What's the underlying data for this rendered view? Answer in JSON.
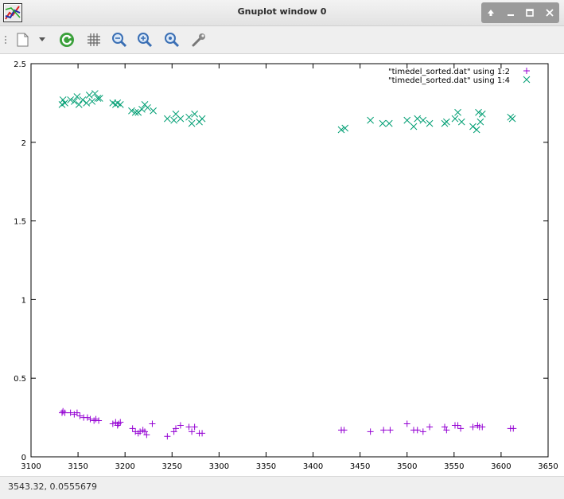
{
  "window": {
    "title": "Gnuplot window 0",
    "controls": [
      "up-icon",
      "minimize-icon",
      "maximize-icon",
      "close-icon"
    ]
  },
  "toolbar": {
    "items": [
      "grip-icon",
      "copy-icon",
      "dropdown-arrow-icon",
      "replot-icon",
      "grid-icon",
      "zoom-previous-icon",
      "zoom-next-icon",
      "unzoom-icon",
      "settings-icon"
    ]
  },
  "status": {
    "coordinates": "3543.32,  0.0555679"
  },
  "colors": {
    "series1": "#9400d3",
    "series2": "#009e73"
  },
  "chart_data": {
    "type": "scatter",
    "xlim": [
      3100,
      3650
    ],
    "ylim": [
      0,
      2.5
    ],
    "xticks": [
      "3100",
      "3150",
      "3200",
      "3250",
      "3300",
      "3350",
      "3400",
      "3450",
      "3500",
      "3550",
      "3600",
      "3650"
    ],
    "yticks": [
      "0",
      "0.5",
      "1",
      "1.5",
      "2",
      "2.5"
    ],
    "legend_position": "top-right",
    "grid": false,
    "series": [
      {
        "name": "\"timedel_sorted.dat\" using 1:2",
        "marker": "plus",
        "points": [
          [
            3133,
            0.28
          ],
          [
            3134,
            0.29
          ],
          [
            3136,
            0.28
          ],
          [
            3142,
            0.28
          ],
          [
            3146,
            0.27
          ],
          [
            3149,
            0.28
          ],
          [
            3152,
            0.26
          ],
          [
            3156,
            0.25
          ],
          [
            3160,
            0.25
          ],
          [
            3163,
            0.24
          ],
          [
            3167,
            0.23
          ],
          [
            3169,
            0.24
          ],
          [
            3172,
            0.23
          ],
          [
            3187,
            0.21
          ],
          [
            3190,
            0.22
          ],
          [
            3192,
            0.2
          ],
          [
            3193,
            0.21
          ],
          [
            3195,
            0.22
          ],
          [
            3208,
            0.18
          ],
          [
            3211,
            0.16
          ],
          [
            3214,
            0.15
          ],
          [
            3216,
            0.16
          ],
          [
            3219,
            0.17
          ],
          [
            3221,
            0.16
          ],
          [
            3223,
            0.14
          ],
          [
            3229,
            0.21
          ],
          [
            3245,
            0.13
          ],
          [
            3252,
            0.16
          ],
          [
            3254,
            0.18
          ],
          [
            3259,
            0.2
          ],
          [
            3268,
            0.19
          ],
          [
            3271,
            0.16
          ],
          [
            3274,
            0.19
          ],
          [
            3279,
            0.15
          ],
          [
            3282,
            0.15
          ],
          [
            3430,
            0.17
          ],
          [
            3433,
            0.17
          ],
          [
            3461,
            0.16
          ],
          [
            3475,
            0.17
          ],
          [
            3482,
            0.17
          ],
          [
            3500,
            0.21
          ],
          [
            3507,
            0.17
          ],
          [
            3511,
            0.17
          ],
          [
            3517,
            0.16
          ],
          [
            3524,
            0.19
          ],
          [
            3540,
            0.19
          ],
          [
            3542,
            0.17
          ],
          [
            3551,
            0.2
          ],
          [
            3554,
            0.2
          ],
          [
            3557,
            0.18
          ],
          [
            3570,
            0.19
          ],
          [
            3575,
            0.2
          ],
          [
            3577,
            0.19
          ],
          [
            3580,
            0.19
          ],
          [
            3610,
            0.18
          ],
          [
            3613,
            0.18
          ]
        ]
      },
      {
        "name": "\"timedel_sorted.dat\" using 1:4",
        "marker": "cross",
        "points": [
          [
            3133,
            2.24
          ],
          [
            3134,
            2.27
          ],
          [
            3136,
            2.25
          ],
          [
            3142,
            2.27
          ],
          [
            3146,
            2.26
          ],
          [
            3149,
            2.29
          ],
          [
            3151,
            2.24
          ],
          [
            3155,
            2.27
          ],
          [
            3159,
            2.25
          ],
          [
            3162,
            2.3
          ],
          [
            3165,
            2.26
          ],
          [
            3168,
            2.31
          ],
          [
            3171,
            2.28
          ],
          [
            3173,
            2.28
          ],
          [
            3187,
            2.25
          ],
          [
            3190,
            2.24
          ],
          [
            3192,
            2.25
          ],
          [
            3195,
            2.24
          ],
          [
            3207,
            2.2
          ],
          [
            3211,
            2.19
          ],
          [
            3214,
            2.19
          ],
          [
            3218,
            2.21
          ],
          [
            3221,
            2.24
          ],
          [
            3224,
            2.22
          ],
          [
            3230,
            2.2
          ],
          [
            3245,
            2.15
          ],
          [
            3252,
            2.14
          ],
          [
            3254,
            2.18
          ],
          [
            3259,
            2.15
          ],
          [
            3268,
            2.16
          ],
          [
            3271,
            2.12
          ],
          [
            3274,
            2.18
          ],
          [
            3279,
            2.13
          ],
          [
            3282,
            2.15
          ],
          [
            3430,
            2.08
          ],
          [
            3434,
            2.09
          ],
          [
            3461,
            2.14
          ],
          [
            3474,
            2.12
          ],
          [
            3481,
            2.12
          ],
          [
            3500,
            2.14
          ],
          [
            3507,
            2.1
          ],
          [
            3511,
            2.15
          ],
          [
            3517,
            2.14
          ],
          [
            3524,
            2.12
          ],
          [
            3540,
            2.12
          ],
          [
            3542,
            2.13
          ],
          [
            3551,
            2.15
          ],
          [
            3554,
            2.19
          ],
          [
            3558,
            2.13
          ],
          [
            3570,
            2.1
          ],
          [
            3574,
            2.08
          ],
          [
            3576,
            2.19
          ],
          [
            3578,
            2.13
          ],
          [
            3580,
            2.18
          ],
          [
            3610,
            2.16
          ],
          [
            3612,
            2.15
          ]
        ]
      }
    ]
  }
}
